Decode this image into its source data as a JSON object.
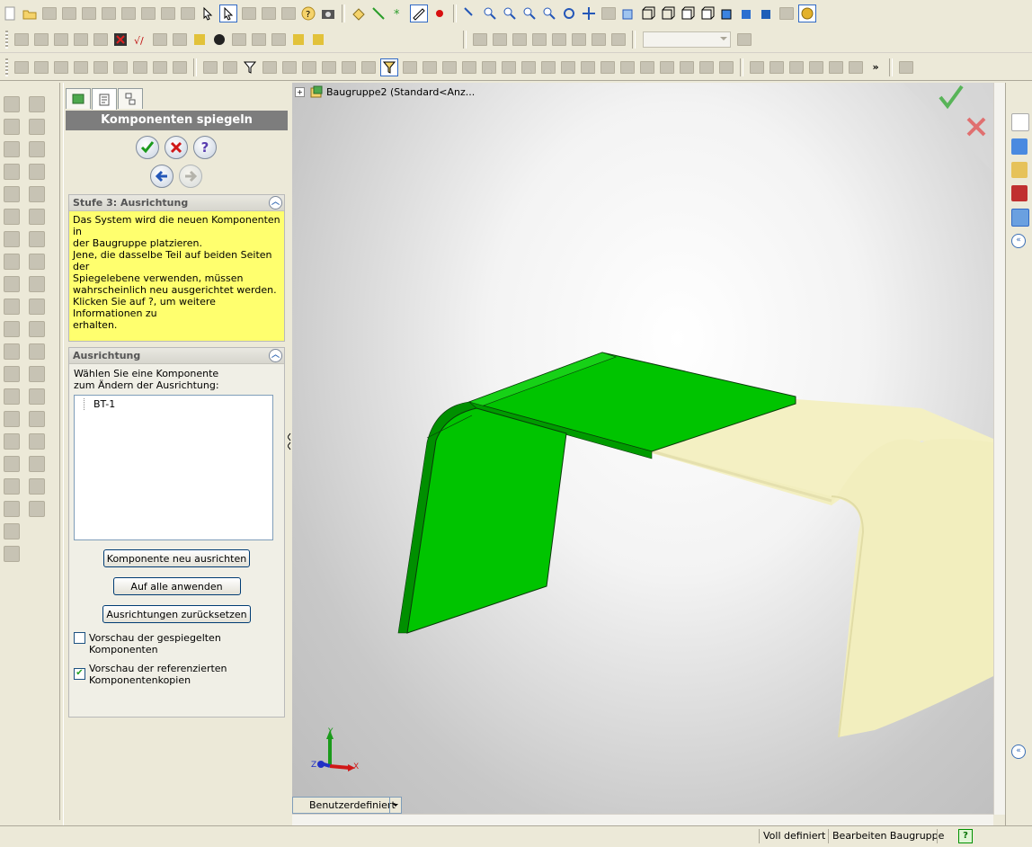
{
  "property_manager": {
    "title": "Komponenten spiegeln",
    "step_group": {
      "title": "Stufe 3: Ausrichtung",
      "message": "Das System wird die neuen Komponenten in\nder Baugruppe platzieren.\nJene, die dasselbe Teil auf beiden Seiten der\nSpiegelebene verwenden, müssen\nwahrscheinlich neu ausgerichtet werden.\nKlicken Sie auf ?, um weitere Informationen zu\nerhalten."
    },
    "orientation_group": {
      "title": "Ausrichtung",
      "hint": "Wählen Sie eine Komponente\nzum Ändern der Ausrichtung:",
      "list_items": [
        "BT-1"
      ],
      "buttons": {
        "reorient": "Komponente neu ausrichten",
        "apply_all": "Auf alle anwenden",
        "reset": "Ausrichtungen zurücksetzen"
      },
      "checkboxes": [
        {
          "label": "Vorschau der gespiegelten Komponenten",
          "checked": false
        },
        {
          "label": "Vorschau der referenzierten\nKomponentenkopien",
          "checked": true
        }
      ]
    }
  },
  "graphics": {
    "tree_label": "Baugruppe2  (Standard<Anz...",
    "view_combo": "Benutzerdefiniert",
    "triad": {
      "x": "X",
      "y": "Y",
      "z": "Z"
    }
  },
  "status_bar": {
    "state": "Voll definiert",
    "mode": "Bearbeiten Baugruppe"
  },
  "colors": {
    "part_green": "#00c400",
    "mirror_yellow": "#f4f0c3",
    "message_bg": "#ffff6e",
    "panel_title_bg": "#7d7d7d"
  }
}
